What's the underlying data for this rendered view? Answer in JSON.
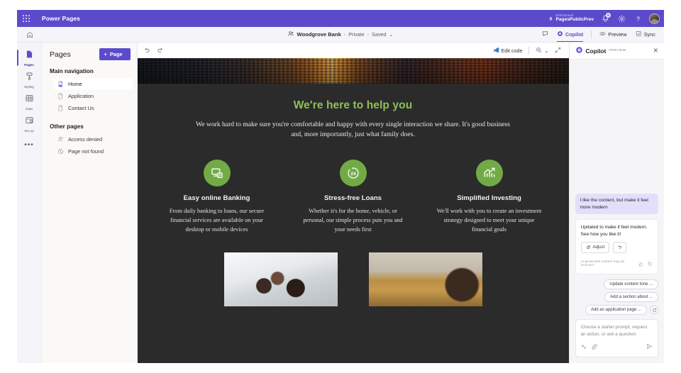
{
  "topbar": {
    "waffle_title": "App launcher",
    "brand": "Power Pages",
    "env_label": "Environment",
    "env_name": "PagesPublicPrev",
    "notification_count": "0",
    "settings_title": "Settings",
    "help_title": "Help"
  },
  "commandbar": {
    "home_title": "Home",
    "site_name": "Woodgrove Bank",
    "sep1": "-",
    "visibility": "Private",
    "sep2": "-",
    "saved_state": "Saved",
    "chevron": "⌄",
    "comments_title": "Comments",
    "copilot": "Copilot",
    "preview": "Preview",
    "sync": "Sync"
  },
  "rail": {
    "items": [
      {
        "label": "Pages",
        "icon": "pages-icon",
        "selected": true
      },
      {
        "label": "Styling",
        "icon": "styling-icon",
        "selected": false
      },
      {
        "label": "Data",
        "icon": "data-icon",
        "selected": false
      },
      {
        "label": "Set up",
        "icon": "setup-icon",
        "selected": false
      }
    ],
    "more": "•••"
  },
  "pages_panel": {
    "title": "Pages",
    "add_button": "Page",
    "add_plus": "+",
    "groups": [
      {
        "title": "Main navigation",
        "items": [
          {
            "label": "Home",
            "icon": "home-page-icon",
            "selected": true
          },
          {
            "label": "Application",
            "icon": "page-icon",
            "selected": false
          },
          {
            "label": "Contact Us",
            "icon": "page-icon",
            "selected": false
          }
        ]
      },
      {
        "title": "Other pages",
        "items": [
          {
            "label": "Access denied",
            "icon": "access-denied-icon",
            "selected": false
          },
          {
            "label": "Page not found",
            "icon": "page-not-found-icon",
            "selected": false
          }
        ]
      }
    ]
  },
  "canvas_toolbar": {
    "undo_title": "Undo",
    "redo_title": "Redo",
    "edit_code": "Edit code",
    "zoom_title": "Zoom",
    "zoom_chevron": "⌄",
    "fullscreen_title": "Expand"
  },
  "site": {
    "heading": "We're here to help you",
    "subheading": "We work hard to make sure you're comfortable and happy with every single interaction we share. It's good business and, more importantly, just what family does.",
    "features": [
      {
        "icon": "online-banking-icon",
        "title": "Easy online Banking",
        "text": "From daily banking to loans, our secure financial services are available on your desktop or mobile devices"
      },
      {
        "icon": "24-hours-icon",
        "title": "Stress-free Loans",
        "text": "Whether it's for the home, vehicle, or personal, our simple process puts you and your needs first"
      },
      {
        "icon": "investing-chart-icon",
        "title": "Simplified Investing",
        "text": "We'll work with you to create an investment strategy designed to meet your unique financial goals"
      }
    ],
    "colors": {
      "accent_green": "#8fbf59",
      "icon_green": "#72ab46",
      "background": "#2b2b2b"
    }
  },
  "copilot": {
    "title": "Copilot",
    "preview_tag": "PREVIEW",
    "close": "✕",
    "messages": [
      {
        "role": "user",
        "text": "I like the content, but make it feel more modern"
      },
      {
        "role": "assistant",
        "text": "Updated to make it feel modern. See how you like it!"
      }
    ],
    "assistant_actions": [
      {
        "label": "Adjust",
        "icon": "adjust-icon"
      },
      {
        "label": "",
        "icon": "undo-icon"
      }
    ],
    "disclaimer": "AI-generated content may be incorrect",
    "thumbs_up": "thumb-up-icon",
    "thumbs_down": "thumb-down-icon",
    "suggestions": [
      "Update content tone ...",
      "Add a section about ...",
      "Add an application page ..."
    ],
    "refresh_title": "Refresh suggestions",
    "composer_placeholder": "Choose a starter prompt, request an action, or ask a question",
    "composer_value": "",
    "prompt_icon": "sparkle-prompt-icon",
    "attach_icon": "attach-icon",
    "send_icon": "send-icon"
  }
}
